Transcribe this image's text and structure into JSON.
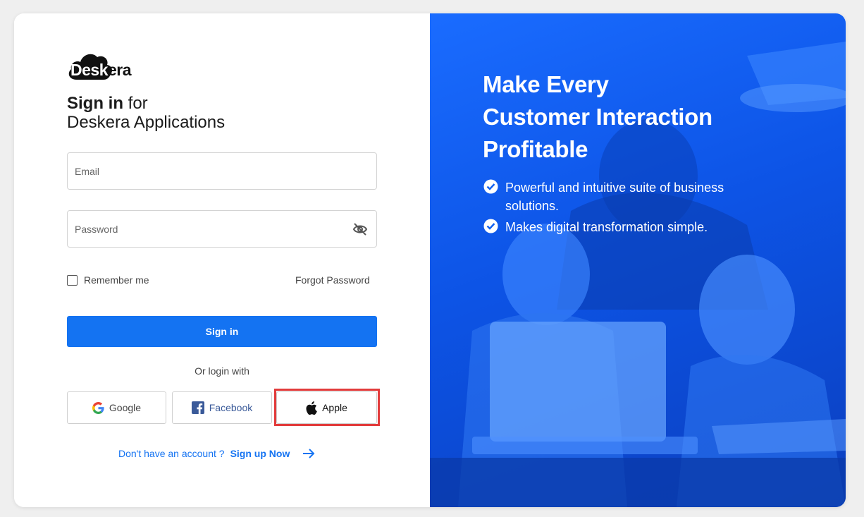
{
  "logo": {
    "text_main": "Desk",
    "text_tail": "era"
  },
  "heading": {
    "bold": "Sign in",
    "light": " for",
    "line2": "Deskera Applications"
  },
  "form": {
    "email_placeholder": "Email",
    "password_placeholder": "Password",
    "remember_label": "Remember me",
    "forgot_label": "Forgot Password",
    "signin_label": "Sign in",
    "or_label": "Or login with"
  },
  "social": {
    "google_label": "Google",
    "facebook_label": "Facebook",
    "apple_label": "Apple"
  },
  "signup": {
    "question": "Don't have an account ?",
    "link": "Sign up Now"
  },
  "hero": {
    "title_line1": "Make Every",
    "title_line2": "Customer Interaction",
    "title_line3": "Profitable",
    "bullets": [
      "Powerful and intuitive suite of business solutions.",
      "Makes digital transformation simple."
    ]
  },
  "colors": {
    "primary": "#1473f2",
    "hero_blue": "#0d54e6",
    "highlight": "#e23b3b"
  },
  "icons": [
    "eye-off-icon",
    "google-icon",
    "facebook-icon",
    "apple-icon",
    "arrow-right-icon",
    "check-circle-icon"
  ]
}
